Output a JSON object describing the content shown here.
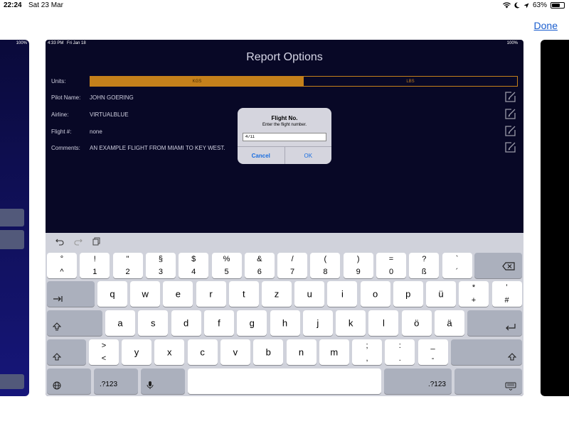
{
  "outer_status": {
    "time": "22:24",
    "date": "Sat 23 Mar",
    "battery": "63%",
    "battery_fraction": 0.63
  },
  "done_label": "Done",
  "left_preview": {
    "battery": "100%"
  },
  "app": {
    "status": {
      "time": "4:33 PM",
      "date": "Fri Jan 18",
      "battery": "100%"
    },
    "title": "Report Options",
    "units": {
      "label": "Units:",
      "options": [
        "KGS",
        "LBS"
      ],
      "selected": "KGS"
    },
    "fields": [
      {
        "label": "Pilot Name:",
        "value": "JOHN GOERING"
      },
      {
        "label": "Airline:",
        "value": "VIRTUALBLUE"
      },
      {
        "label": "Flight #:",
        "value": "none"
      },
      {
        "label": "Comments:",
        "value": "AN EXAMPLE FLIGHT FROM MIAMI TO KEY WEST."
      }
    ],
    "edit_icon": "edit-icon"
  },
  "alert": {
    "title": "Flight No.",
    "message": "Enter the flight number.",
    "input_value": "4711",
    "cancel": "Cancel",
    "ok": "OK"
  },
  "keyboard": {
    "row1": [
      {
        "top": "°",
        "bottom": "^"
      },
      {
        "top": "!",
        "bottom": "1"
      },
      {
        "top": "\"",
        "bottom": "2"
      },
      {
        "top": "§",
        "bottom": "3"
      },
      {
        "top": "$",
        "bottom": "4"
      },
      {
        "top": "%",
        "bottom": "5"
      },
      {
        "top": "&",
        "bottom": "6"
      },
      {
        "top": "/",
        "bottom": "7"
      },
      {
        "top": "(",
        "bottom": "8"
      },
      {
        "top": ")",
        "bottom": "9"
      },
      {
        "top": "=",
        "bottom": "0"
      },
      {
        "top": "?",
        "bottom": "ß"
      },
      {
        "top": "`",
        "bottom": "´"
      }
    ],
    "row2": [
      "q",
      "w",
      "e",
      "r",
      "t",
      "z",
      "u",
      "i",
      "o",
      "p",
      "ü"
    ],
    "row2_extra": [
      {
        "top": "*",
        "bottom": "+"
      },
      {
        "top": "’",
        "bottom": "#"
      }
    ],
    "row3": [
      "a",
      "s",
      "d",
      "f",
      "g",
      "h",
      "j",
      "k",
      "l",
      "ö",
      "ä"
    ],
    "row4_first": {
      "top": ">",
      "bottom": "<"
    },
    "row4": [
      "y",
      "x",
      "c",
      "v",
      "b",
      "n",
      "m"
    ],
    "row4_punct": [
      {
        "top": ";",
        "bottom": ","
      },
      {
        "top": ":",
        "bottom": "."
      },
      {
        "top": "_",
        "bottom": "-"
      }
    ],
    "numbers_label": ".?123"
  }
}
